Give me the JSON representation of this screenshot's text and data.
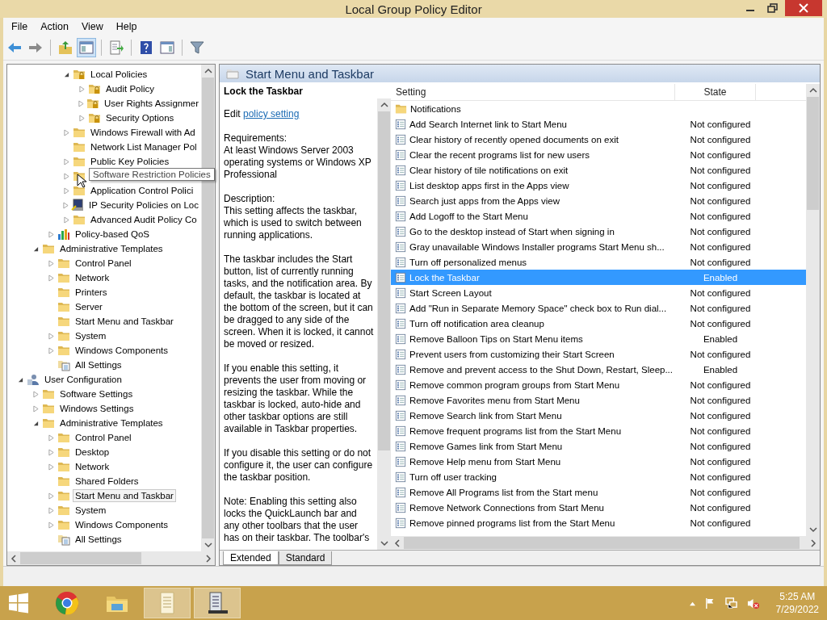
{
  "window": {
    "title": "Local Group Policy Editor"
  },
  "menu": [
    "File",
    "Action",
    "View",
    "Help"
  ],
  "toolbar": [
    [
      {
        "kind": "back",
        "pressed": false
      },
      {
        "kind": "forward",
        "pressed": false
      }
    ],
    [
      {
        "kind": "up",
        "pressed": false
      },
      {
        "kind": "tree",
        "pressed": true
      }
    ],
    [
      {
        "kind": "export",
        "pressed": false
      }
    ],
    [
      {
        "kind": "help",
        "pressed": false
      },
      {
        "kind": "actions",
        "pressed": false
      }
    ],
    [
      {
        "kind": "filter",
        "pressed": false
      }
    ]
  ],
  "tree": [
    {
      "children": [
        {
          "children": [
            {
              "children": [
                {
                  "label": "Local Policies",
                  "expanded": true,
                  "kind": "lock-folder",
                  "selected": false,
                  "children": [
                    {
                      "label": "Audit Policy",
                      "expanded": false,
                      "kind": "lock-folder",
                      "selected": false
                    },
                    {
                      "label": "User Rights Assignmer",
                      "expanded": false,
                      "kind": "lock-folder",
                      "selected": false
                    },
                    {
                      "label": "Security Options",
                      "expanded": false,
                      "kind": "lock-folder",
                      "selected": false
                    }
                  ]
                },
                {
                  "label": "Windows Firewall with Ad",
                  "expanded": false,
                  "kind": "folder",
                  "selected": false
                },
                {
                  "label": "Network List Manager Pol",
                  "kind": "folder",
                  "selected": false
                },
                {
                  "label": "Public Key Policies",
                  "expanded": false,
                  "kind": "folder",
                  "selected": false
                },
                {
                  "tooltip": "Software Restriction Policies",
                  "expanded": false,
                  "kind": "folder"
                },
                {
                  "label": "Application Control Polici",
                  "expanded": false,
                  "kind": "folder",
                  "selected": false
                },
                {
                  "label": "IP Security Policies on Loc",
                  "expanded": false,
                  "kind": "computer",
                  "selected": false
                },
                {
                  "label": "Advanced Audit Policy Co",
                  "expanded": false,
                  "kind": "folder",
                  "selected": false
                }
              ]
            },
            {
              "label": "Policy-based QoS",
              "expanded": false,
              "kind": "chart",
              "selected": false
            }
          ]
        },
        {
          "label": "Administrative Templates",
          "expanded": true,
          "kind": "folder",
          "selected": false,
          "children": [
            {
              "label": "Control Panel",
              "expanded": false,
              "kind": "folder",
              "selected": false
            },
            {
              "label": "Network",
              "expanded": false,
              "kind": "folder",
              "selected": false
            },
            {
              "label": "Printers",
              "kind": "folder",
              "selected": false
            },
            {
              "label": "Server",
              "kind": "folder",
              "selected": false
            },
            {
              "label": "Start Menu and Taskbar",
              "kind": "folder",
              "selected": false
            },
            {
              "label": "System",
              "expanded": false,
              "kind": "folder",
              "selected": false
            },
            {
              "label": "Windows Components",
              "expanded": false,
              "kind": "folder",
              "selected": false
            },
            {
              "label": "All Settings",
              "kind": "settings",
              "selected": false
            }
          ]
        }
      ]
    },
    {
      "label": "User Configuration",
      "expanded": true,
      "kind": "user",
      "selected": false,
      "children": [
        {
          "label": "Software Settings",
          "expanded": false,
          "kind": "folder",
          "selected": false
        },
        {
          "label": "Windows Settings",
          "expanded": false,
          "kind": "folder",
          "selected": false
        },
        {
          "label": "Administrative Templates",
          "expanded": true,
          "kind": "folder",
          "selected": false,
          "children": [
            {
              "label": "Control Panel",
              "expanded": false,
              "kind": "folder",
              "selected": false
            },
            {
              "label": "Desktop",
              "expanded": false,
              "kind": "folder",
              "selected": false
            },
            {
              "label": "Network",
              "expanded": false,
              "kind": "folder",
              "selected": false
            },
            {
              "label": "Shared Folders",
              "kind": "folder",
              "selected": false
            },
            {
              "label": "Start Menu and Taskbar",
              "expanded": false,
              "kind": "folder",
              "selected": true
            },
            {
              "label": "System",
              "expanded": false,
              "kind": "folder",
              "selected": false
            },
            {
              "label": "Windows Components",
              "expanded": false,
              "kind": "folder",
              "selected": false
            },
            {
              "label": "All Settings",
              "kind": "settings",
              "selected": false
            }
          ]
        }
      ]
    }
  ],
  "panel": {
    "title": "Start Menu and Taskbar"
  },
  "description": {
    "title": "Lock the Taskbar",
    "edit_prefix": "Edit",
    "edit_link": "policy setting",
    "requirements_label": "Requirements:",
    "requirements": "At least Windows Server 2003 operating systems or Windows XP Professional",
    "description_label": "Description:",
    "paragraphs": [
      "This setting affects the taskbar, which is used to switch between running applications.",
      "The taskbar includes the Start button, list of currently running tasks, and the notification area. By default, the taskbar is located at the bottom of the screen, but it can be dragged to any side of the screen. When it is locked, it cannot be moved or resized.",
      "If you enable this setting, it prevents the user from moving or resizing the taskbar. While the taskbar is locked, auto-hide and other taskbar options are still available in Taskbar properties.",
      "If you disable this setting or do not configure it, the user can configure the taskbar position.",
      "Note: Enabling this setting also locks the QuickLaunch bar and any other toolbars that the user has on their taskbar. The toolbar's"
    ]
  },
  "settings": {
    "columns": [
      "Setting",
      "State"
    ],
    "rows": [
      {
        "kind": "folder",
        "name": "Notifications",
        "selected": false
      },
      {
        "kind": "policy",
        "name": "Add Search Internet link to Start Menu",
        "state": "Not configured",
        "selected": false
      },
      {
        "kind": "policy",
        "name": "Clear history of recently opened documents on exit",
        "state": "Not configured",
        "selected": false
      },
      {
        "kind": "policy",
        "name": "Clear the recent programs list for new users",
        "state": "Not configured",
        "selected": false
      },
      {
        "kind": "policy",
        "name": "Clear history of tile notifications on exit",
        "state": "Not configured",
        "selected": false
      },
      {
        "kind": "policy",
        "name": "List desktop apps first in the Apps view",
        "state": "Not configured",
        "selected": false
      },
      {
        "kind": "policy",
        "name": "Search just apps from the Apps view",
        "state": "Not configured",
        "selected": false
      },
      {
        "kind": "policy",
        "name": "Add Logoff to the Start Menu",
        "state": "Not configured",
        "selected": false
      },
      {
        "kind": "policy",
        "name": "Go to the desktop instead of Start when signing in",
        "state": "Not configured",
        "selected": false
      },
      {
        "kind": "policy",
        "name": "Gray unavailable Windows Installer programs Start Menu sh...",
        "state": "Not configured",
        "selected": false
      },
      {
        "kind": "policy",
        "name": "Turn off personalized menus",
        "state": "Not configured",
        "selected": false
      },
      {
        "kind": "policy",
        "name": "Lock the Taskbar",
        "state": "Enabled",
        "selected": true
      },
      {
        "kind": "policy",
        "name": "Start Screen Layout",
        "state": "Not configured",
        "selected": false
      },
      {
        "kind": "policy",
        "name": "Add \"Run in Separate Memory Space\" check box to Run dial...",
        "state": "Not configured",
        "selected": false
      },
      {
        "kind": "policy",
        "name": "Turn off notification area cleanup",
        "state": "Not configured",
        "selected": false
      },
      {
        "kind": "policy",
        "name": "Remove Balloon Tips on Start Menu items",
        "state": "Enabled",
        "selected": false
      },
      {
        "kind": "policy",
        "name": "Prevent users from customizing their Start Screen",
        "state": "Not configured",
        "selected": false
      },
      {
        "kind": "policy",
        "name": "Remove and prevent access to the Shut Down, Restart, Sleep...",
        "state": "Enabled",
        "selected": false
      },
      {
        "kind": "policy",
        "name": "Remove common program groups from Start Menu",
        "state": "Not configured",
        "selected": false
      },
      {
        "kind": "policy",
        "name": "Remove Favorites menu from Start Menu",
        "state": "Not configured",
        "selected": false
      },
      {
        "kind": "policy",
        "name": "Remove Search link from Start Menu",
        "state": "Not configured",
        "selected": false
      },
      {
        "kind": "policy",
        "name": "Remove frequent programs list from the Start Menu",
        "state": "Not configured",
        "selected": false
      },
      {
        "kind": "policy",
        "name": "Remove Games link from Start Menu",
        "state": "Not configured",
        "selected": false
      },
      {
        "kind": "policy",
        "name": "Remove Help menu from Start Menu",
        "state": "Not configured",
        "selected": false
      },
      {
        "kind": "policy",
        "name": "Turn off user tracking",
        "state": "Not configured",
        "selected": false
      },
      {
        "kind": "policy",
        "name": "Remove All Programs list from the Start menu",
        "state": "Not configured",
        "selected": false
      },
      {
        "kind": "policy",
        "name": "Remove Network Connections from Start Menu",
        "state": "Not configured",
        "selected": false
      },
      {
        "kind": "policy",
        "name": "Remove pinned programs list from the Start Menu",
        "state": "Not configured",
        "selected": false
      }
    ]
  },
  "tabs": [
    {
      "label": "Extended",
      "selected": true
    },
    {
      "label": "Standard",
      "selected": false
    }
  ],
  "taskbar": {
    "apps": [
      {
        "kind": "browser",
        "active": false
      },
      {
        "kind": "explorer",
        "active": false
      },
      {
        "kind": "notepad",
        "active": true
      },
      {
        "kind": "server",
        "active": true
      }
    ],
    "time": "5:25 AM",
    "date": "7/29/2022"
  }
}
